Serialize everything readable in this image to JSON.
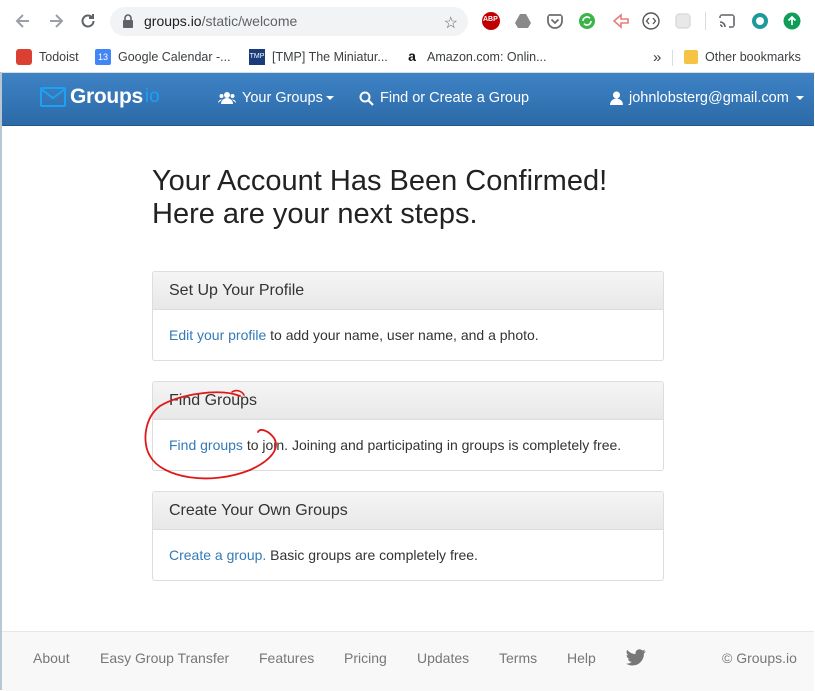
{
  "browser": {
    "url_domain": "groups.io",
    "url_path": "/static/welcome",
    "extensions": [
      "abp-icon",
      "drive-icon",
      "pocket-icon",
      "sync-icon",
      "send-icon",
      "code-icon",
      "puzzle-icon",
      "cast-icon",
      "circle-icon",
      "upload-icon"
    ],
    "abp_label": "ABP",
    "bookmarks": [
      {
        "label": "Todoist",
        "icon": "todoist-icon",
        "color": "#db4035"
      },
      {
        "label": "Google Calendar -...",
        "icon": "calendar-icon",
        "color": "#4285f4"
      },
      {
        "label": "[TMP] The Miniatur...",
        "icon": "tmp-icon",
        "color": "#1a3c7a"
      },
      {
        "label": "Amazon.com: Onlin...",
        "icon": "amazon-icon",
        "color": "#ff9900"
      }
    ],
    "overflow_label": "»",
    "other_bookmarks": "Other bookmarks",
    "calendar_day": "13",
    "tmp_glyph": "TMP",
    "amazon_glyph": "a"
  },
  "navbar": {
    "brand": "Groups",
    "brand_suffix": "io",
    "your_groups": "Your Groups",
    "find_create": "Find or Create a Group",
    "account": "johnlobsterg@gmail.com",
    "color": "#3378bd"
  },
  "page": {
    "headline_line1": "Your Account Has Been Confirmed!",
    "headline_line2": "Here are your next steps.",
    "panels": [
      {
        "title": "Set Up Your Profile",
        "link": "Edit your profile",
        "text": " to add your name, user name, and a photo."
      },
      {
        "title": "Find Groups",
        "link": "Find groups",
        "text": " to join. Joining and participating in groups is completely free."
      },
      {
        "title": "Create Your Own Groups",
        "link": "Create a group.",
        "text": " Basic groups are completely free."
      }
    ]
  },
  "footer": {
    "links": [
      "About",
      "Easy Group Transfer",
      "Features",
      "Pricing",
      "Updates",
      "Terms",
      "Help"
    ],
    "twitter_icon": "twitter-icon",
    "copyright": "© Groups.io"
  }
}
